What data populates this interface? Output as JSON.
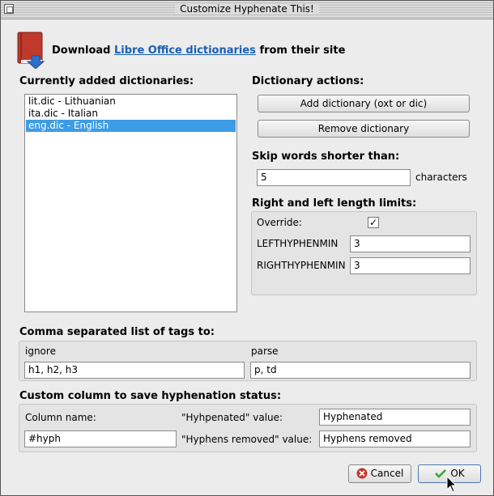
{
  "window": {
    "title": "Customize Hyphenate This!"
  },
  "download": {
    "prefix": "Download",
    "link": "Libre Office dictionaries",
    "suffix": "from their site"
  },
  "dictionaries": {
    "heading": "Currently added dictionaries:",
    "items": [
      {
        "label": "lit.dic - Lithuanian",
        "selected": false
      },
      {
        "label": "ita.dic - Italian",
        "selected": false
      },
      {
        "label": "eng.dic - English",
        "selected": true
      }
    ]
  },
  "actions": {
    "heading": "Dictionary actions:",
    "add_label": "Add dictionary (oxt or dic)",
    "remove_label": "Remove dictionary"
  },
  "skip": {
    "heading": "Skip words shorter than:",
    "value": "5",
    "unit": "characters"
  },
  "limits": {
    "heading": "Right and left length limits:",
    "override_label": "Override:",
    "override_checked": true,
    "checkmark": "✓",
    "left_label": "LEFTHYPHENMIN",
    "left_value": "3",
    "right_label": "RIGHTHYPHENMIN",
    "right_value": "3"
  },
  "tags": {
    "heading": "Comma separated list of tags to:",
    "ignore_label": "ignore",
    "ignore_value": "h1, h2, h3",
    "parse_label": "parse",
    "parse_value": "p, td"
  },
  "column": {
    "heading": "Custom column to save hyphenation status:",
    "name_label": "Column name:",
    "name_value": "#hyph",
    "hyphenated_label": "\"Hyhpenated\" value:",
    "hyphenated_value": "Hyphenated",
    "removed_label": "\"Hyphens removed\" value:",
    "removed_value": "Hyphens removed"
  },
  "buttons": {
    "cancel_label": "Cancel",
    "ok_label": "OK"
  },
  "colors": {
    "link": "#1a5fb4",
    "selection": "#3d9ce6",
    "cancel_icon": "#c0392b",
    "ok_icon": "#3aa53a"
  }
}
